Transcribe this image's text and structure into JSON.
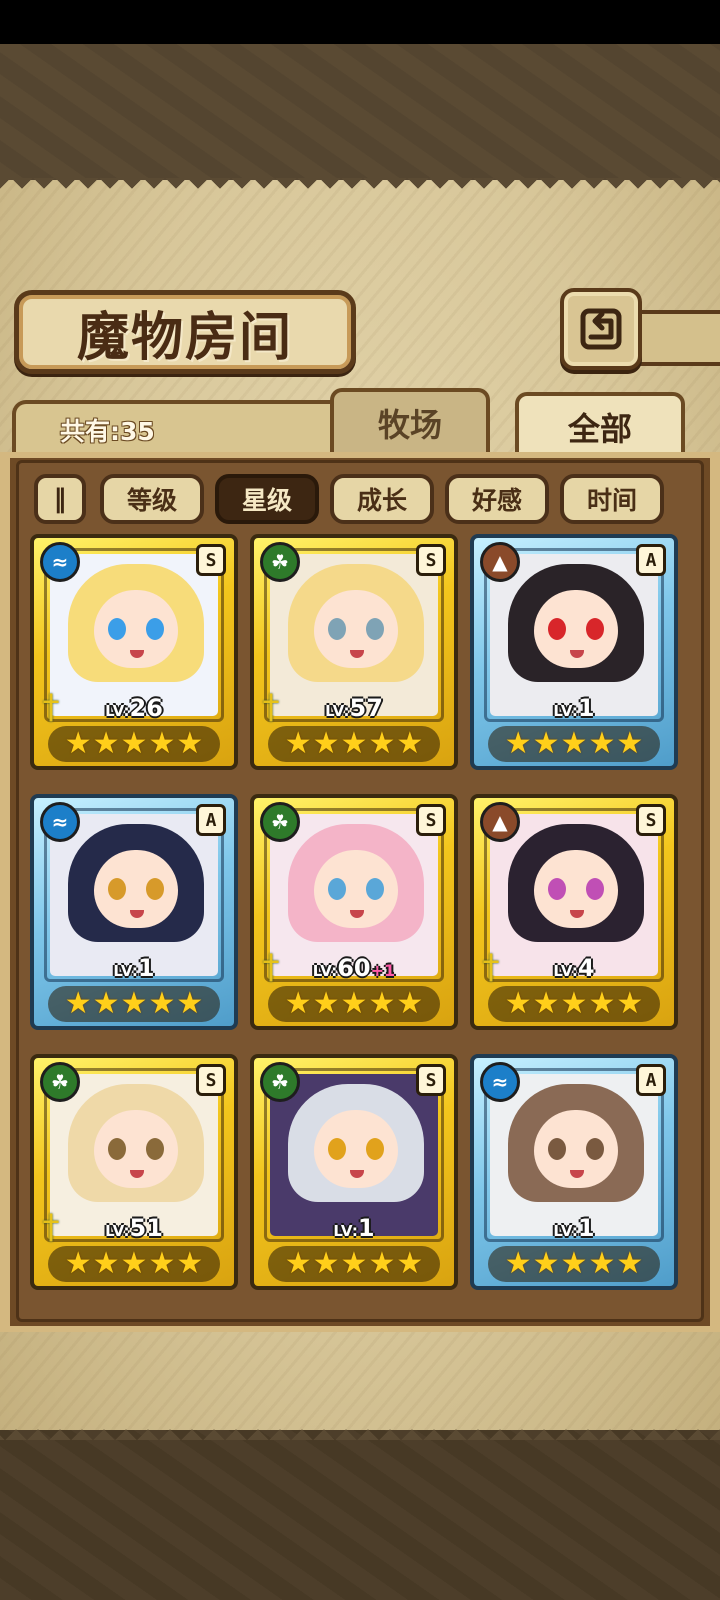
{
  "screen": {
    "title": "魔物房间",
    "count_label": "共有:35",
    "tabs": [
      {
        "label": "牧场",
        "selected": false
      },
      {
        "label": "全部",
        "selected": true
      }
    ],
    "filter_toggle_icon": "pause-sort-icon",
    "filters": [
      {
        "label": "等级",
        "active": false
      },
      {
        "label": "星级",
        "active": true
      },
      {
        "label": "成长",
        "active": false
      },
      {
        "label": "好感",
        "active": false
      },
      {
        "label": "时间",
        "active": false
      }
    ]
  },
  "colors": {
    "gold_frame": "#f3c61d",
    "blue_frame": "#7fc7ea",
    "water": "#1c7fc9",
    "wood": "#2e7a2a",
    "earth": "#8a4a2a",
    "star": "#ffcf1a",
    "level_bonus": "#ff5aa8"
  },
  "monsters": [
    {
      "rank": "S",
      "element": "water",
      "lv_prefix": "LV:",
      "lv": "26",
      "bonus": "",
      "stars": 5,
      "has_weapon": true,
      "frame": "gold",
      "hair": "#f7dc7a",
      "eye": "#3b9ee8",
      "bg": "#f1f4fb"
    },
    {
      "rank": "S",
      "element": "wood",
      "lv_prefix": "LV:",
      "lv": "57",
      "bonus": "",
      "stars": 5,
      "has_weapon": true,
      "frame": "gold",
      "hair": "#f5d98a",
      "eye": "#7fa3b5",
      "bg": "#f3ead8"
    },
    {
      "rank": "A",
      "element": "earth",
      "lv_prefix": "LV:",
      "lv": "1",
      "bonus": "",
      "stars": 5,
      "has_weapon": false,
      "frame": "blue",
      "hair": "#2a2328",
      "eye": "#d8262a",
      "bg": "#ececf0"
    },
    {
      "rank": "A",
      "element": "water",
      "lv_prefix": "LV:",
      "lv": "1",
      "bonus": "",
      "stars": 5,
      "has_weapon": false,
      "frame": "blue",
      "hair": "#252a4a",
      "eye": "#d79a2a",
      "bg": "#e9eaf3"
    },
    {
      "rank": "S",
      "element": "wood",
      "lv_prefix": "LV:",
      "lv": "60",
      "bonus": "+1",
      "stars": 5,
      "has_weapon": true,
      "frame": "gold",
      "hair": "#f4b4c8",
      "eye": "#5aa7d8",
      "bg": "#f6e7ee"
    },
    {
      "rank": "S",
      "element": "earth",
      "lv_prefix": "LV:",
      "lv": "4",
      "bonus": "",
      "stars": 5,
      "has_weapon": true,
      "frame": "gold",
      "hair": "#2b2230",
      "eye": "#c04fb5",
      "bg": "#f7e3ea"
    },
    {
      "rank": "S",
      "element": "wood",
      "lv_prefix": "LV:",
      "lv": "51",
      "bonus": "",
      "stars": 5,
      "has_weapon": true,
      "frame": "gold",
      "hair": "#efd9a8",
      "eye": "#8a6a3a",
      "bg": "#f6efe0"
    },
    {
      "rank": "S",
      "element": "wood",
      "lv_prefix": "LV:",
      "lv": "1",
      "bonus": "",
      "stars": 5,
      "has_weapon": false,
      "frame": "gold",
      "hair": "#d9dde6",
      "eye": "#e1a21c",
      "bg": "#4a3a6a"
    },
    {
      "rank": "A",
      "element": "water",
      "lv_prefix": "LV:",
      "lv": "1",
      "bonus": "",
      "stars": 5,
      "has_weapon": false,
      "frame": "blue",
      "hair": "#8a6a55",
      "eye": "#7a5a40",
      "bg": "#eef0f2"
    }
  ]
}
